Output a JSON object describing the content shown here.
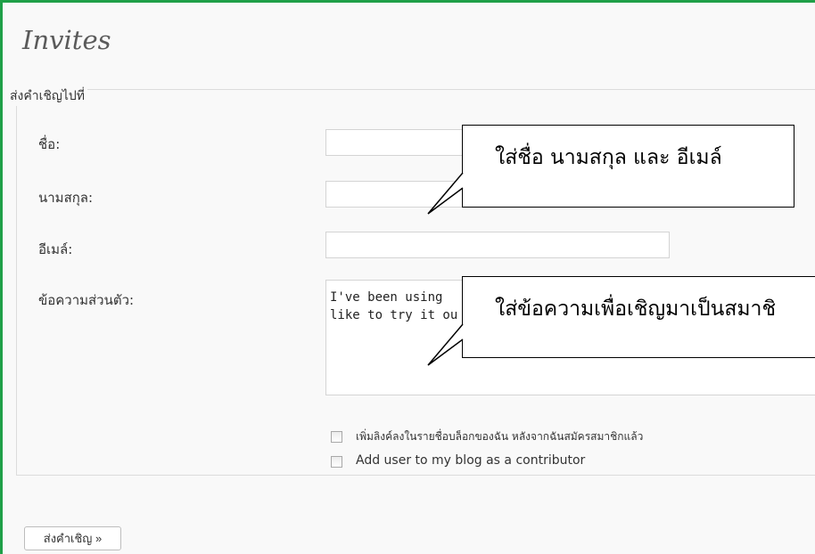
{
  "page": {
    "title": "Invites",
    "legend": "ส่งคำเชิญไปที่"
  },
  "form": {
    "first_name_label": "ชื่อ:",
    "last_name_label": "นามสกุล:",
    "email_label": "อีเมล์:",
    "message_label": "ข้อความส่วนตัว:",
    "first_name_value": "",
    "last_name_value": "",
    "email_value": "",
    "message_value": "I've been using\nlike to try it ou",
    "checkbox_link_label": "เพิ่มลิงค์ลงในรายชื่อบล็อกของฉัน หลังจากฉันสมัครสมาชิกแล้ว",
    "checkbox_contributor_label": "Add user to my blog as a contributor",
    "checkbox_link_checked": false,
    "checkbox_contributor_checked": false,
    "submit_label": "ส่งคำเชิญ »"
  },
  "annotations": {
    "callout_name": "ใส่ชื่อ นามสกุล และ อีเมล์",
    "callout_message": "ใส่ข้อความเพื่อเชิญมาเป็นสมาชิ"
  },
  "colors": {
    "frame_border": "#1fa048",
    "background": "#f9f9f9"
  }
}
